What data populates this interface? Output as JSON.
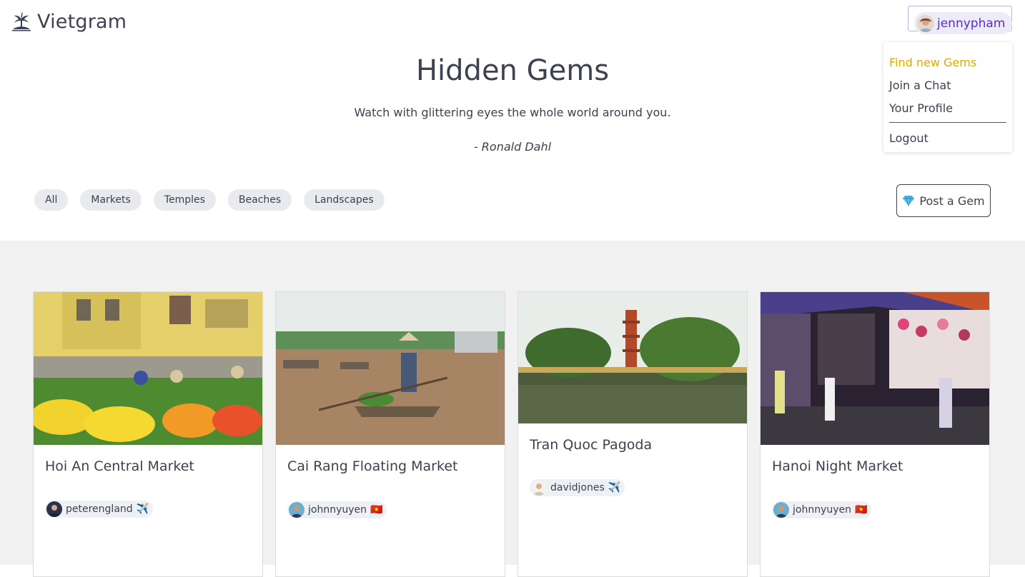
{
  "app": {
    "name": "Vietgram",
    "logo_icon": "palm-tree-island-icon"
  },
  "user": {
    "username": "jennypham",
    "avatar_icon": "user-avatar"
  },
  "menu": {
    "items": [
      {
        "label": "Find new Gems",
        "active": true
      },
      {
        "label": "Join a Chat",
        "active": false
      },
      {
        "label": "Your Profile",
        "active": false
      }
    ],
    "logout_label": "Logout",
    "active_color": "#e5a800"
  },
  "hero": {
    "title": "Hidden Gems",
    "quote": "Watch with glittering eyes the whole world around you.",
    "author": "- Ronald Dahl"
  },
  "filters": [
    "All",
    "Markets",
    "Temples",
    "Beaches",
    "Landscapes"
  ],
  "post_button": {
    "label": "Post a Gem",
    "icon": "diamond-icon"
  },
  "cards": [
    {
      "title": "Hoi An Central Market",
      "author": "peterengland",
      "badge": "✈️",
      "photo": "flower-market-photo"
    },
    {
      "title": "Cai Rang Floating Market",
      "author": "johnnyuyen",
      "badge": "🇻🇳",
      "photo": "floating-market-photo"
    },
    {
      "title": "Tran Quoc Pagoda",
      "author": "davidjones",
      "badge": "✈️",
      "photo": "pagoda-photo"
    },
    {
      "title": "Hanoi Night Market",
      "author": "johnnyuyen",
      "badge": "🇻🇳",
      "photo": "night-market-photo"
    }
  ],
  "colors": {
    "text": "#3d4150",
    "username": "#5a2bd9",
    "chip_bg": "#e9eaee",
    "gallery_bg": "#f1f1f1"
  }
}
